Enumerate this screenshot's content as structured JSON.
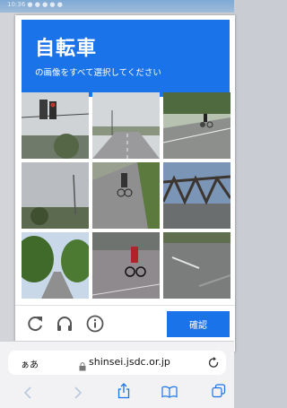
{
  "status_bar": {
    "text": "10:36 ● ● ● ● ●"
  },
  "captcha": {
    "title": "自転車",
    "instruction": "の画像をすべて選択してください",
    "tiles": [
      "traffic-light-scene",
      "road-scene",
      "cyclist-on-road",
      "streetlight-scene",
      "cyclist-path",
      "steel-bridge",
      "tree-lined-street",
      "cyclist-street",
      "pavement-scene"
    ],
    "verify_label": "確認",
    "icons": [
      "reload-icon",
      "audio-icon",
      "info-icon"
    ]
  },
  "browser": {
    "aa_label": "ぁあ",
    "url": "shinsei.jsdc.or.jp"
  },
  "colors": {
    "accent": "#1a73e8"
  }
}
